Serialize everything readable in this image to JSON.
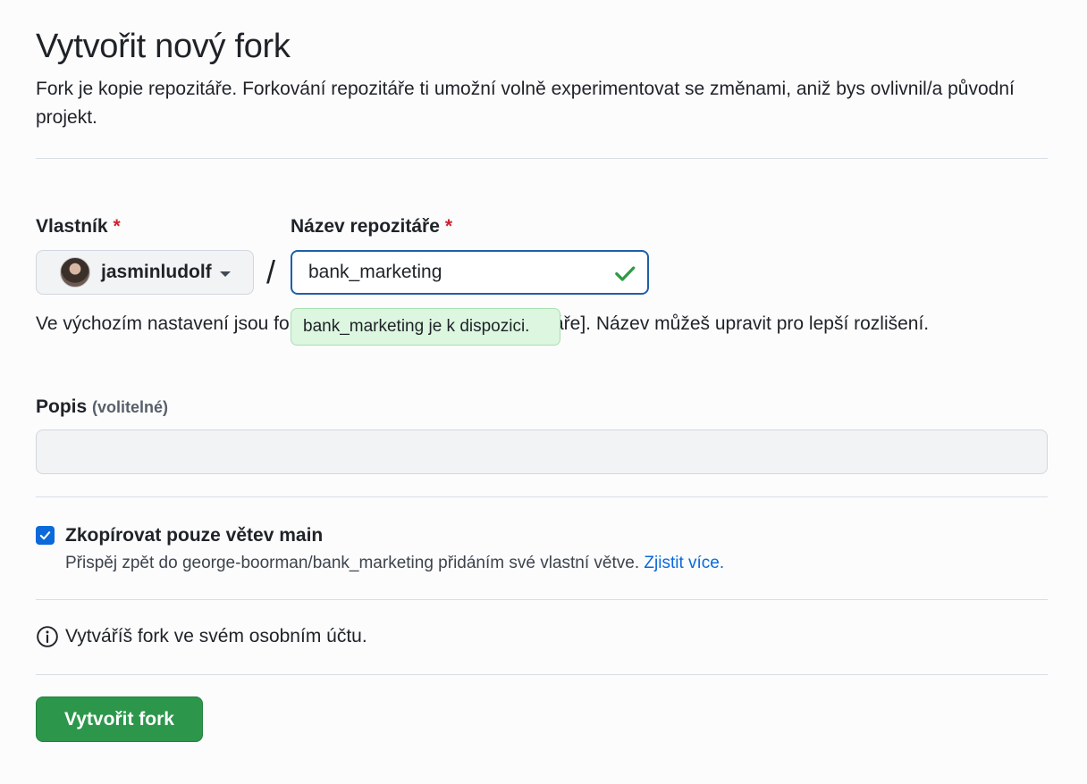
{
  "header": {
    "title": "Vytvořit nový fork",
    "intro": "Fork je kopie repozitáře. Forkování repozitáře ti umožní volně experimentovat se změnami, aniž bys ovlivnil/a původní projekt."
  },
  "form": {
    "owner_label": "Vlastník",
    "owner_value": "jasminludolf",
    "repo_label": "Název repozitáře",
    "required_mark": "*",
    "separator": "/",
    "repo_value": "bank_marketing",
    "availability_tooltip": "bank_marketing je k dispozici.",
    "helper_text": "Ve výchozím nastavení jsou forky pojmenovány [název repozitáře]. Název můžeš upravit pro lepší rozlišení.",
    "description_label": "Popis",
    "description_optional": "(volitelné)",
    "description_value": ""
  },
  "branch_option": {
    "checked": true,
    "label": "Zkopírovat pouze větev main",
    "note": "Přispěj zpět do george-boorman/bank_marketing přidáním své vlastní větve.",
    "link_text": "Zjistit více."
  },
  "info": {
    "text": "Vytváříš fork ve svém osobním účtu."
  },
  "actions": {
    "create_label": "Vytvořit fork"
  },
  "colors": {
    "primary_button": "#2c974b",
    "input_focus_border": "#1f5fa8",
    "success_check": "#2f9a45",
    "tooltip_bg": "#dcf6df",
    "link": "#0969da",
    "required": "#cf222e"
  },
  "icons": {
    "check": "check-icon",
    "info": "info-icon",
    "caret": "chevron-down-icon"
  }
}
